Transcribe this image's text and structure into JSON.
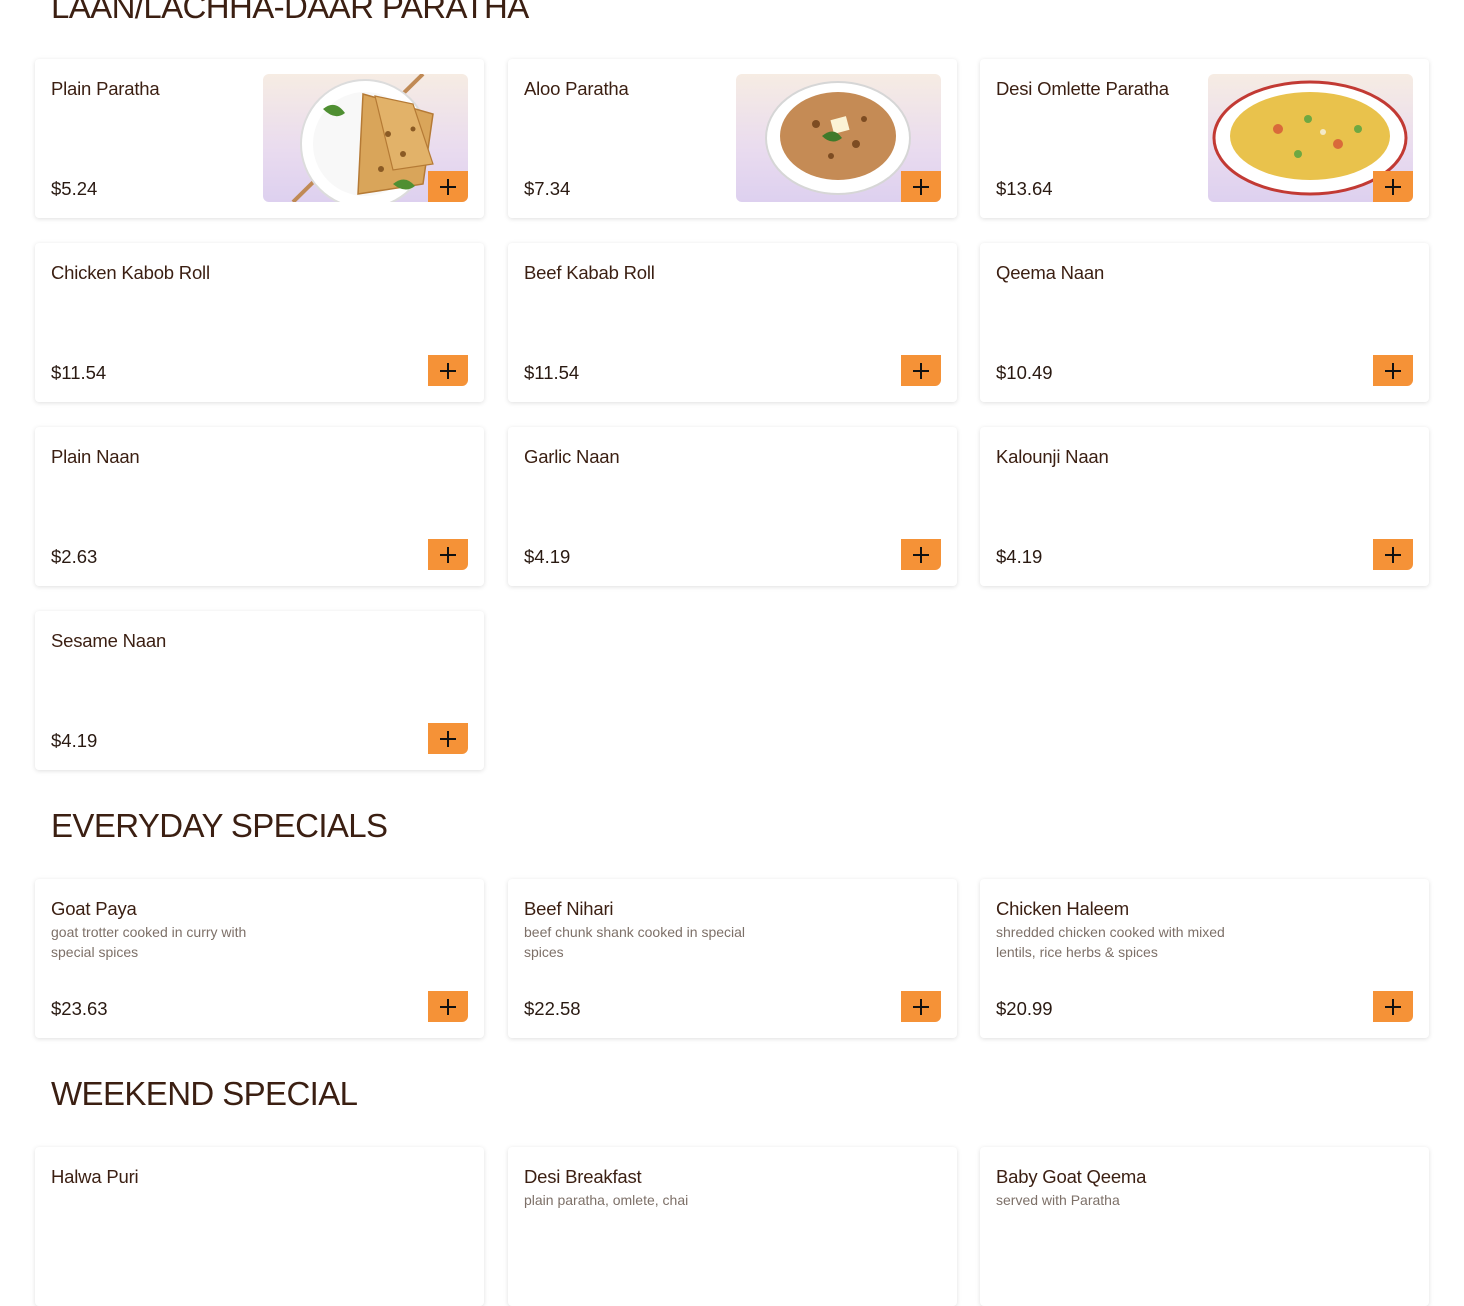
{
  "sections": [
    {
      "title": "LAAN/LACHHA-DAAR PARATHA",
      "items": [
        {
          "name": "Plain Paratha",
          "price": "$5.24"
        },
        {
          "name": "Aloo Paratha",
          "price": "$7.34"
        },
        {
          "name": "Desi Omlette Paratha",
          "price": "$13.64"
        },
        {
          "name": "Chicken Kabob Roll",
          "price": "$11.54"
        },
        {
          "name": "Beef Kabab Roll",
          "price": "$11.54"
        },
        {
          "name": "Qeema Naan",
          "price": "$10.49"
        },
        {
          "name": "Plain Naan",
          "price": "$2.63"
        },
        {
          "name": "Garlic Naan",
          "price": "$4.19"
        },
        {
          "name": "Kalounji Naan",
          "price": "$4.19"
        },
        {
          "name": "Sesame Naan",
          "price": "$4.19"
        }
      ]
    },
    {
      "title": "EVERYDAY SPECIALS",
      "items": [
        {
          "name": "Goat Paya",
          "description": "goat trotter cooked in curry with special spices",
          "price": "$23.63"
        },
        {
          "name": "Beef Nihari",
          "description": "beef chunk shank cooked in special spices",
          "price": "$22.58"
        },
        {
          "name": "Chicken Haleem",
          "description": "shredded chicken cooked with mixed lentils, rice herbs & spices",
          "price": "$20.99"
        }
      ]
    },
    {
      "title": "WEEKEND SPECIAL",
      "items": [
        {
          "name": "Halwa Puri"
        },
        {
          "name": "Desi Breakfast",
          "description": "plain paratha, omlete, chai"
        },
        {
          "name": "Baby Goat Qeema",
          "description": "served with Paratha"
        }
      ]
    }
  ],
  "icons": {
    "add": "plus-icon"
  },
  "colors": {
    "accent": "#f59237",
    "text": "#3b1f12",
    "muted": "#7d7068"
  }
}
